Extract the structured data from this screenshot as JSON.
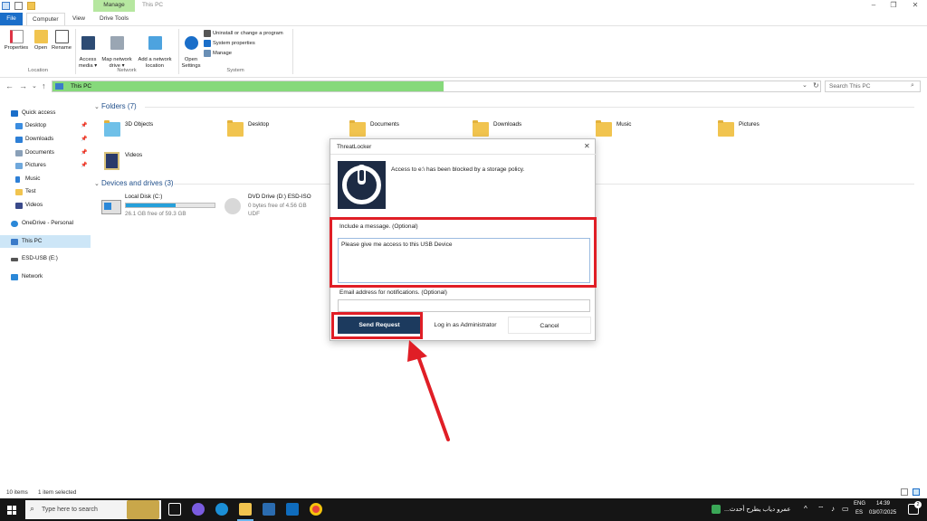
{
  "window": {
    "title": "This PC",
    "manage_tab": "Manage"
  },
  "ribbon": {
    "tabs": [
      "File",
      "Computer",
      "View",
      "Drive Tools"
    ],
    "location_group": {
      "label": "Location",
      "buttons": [
        "Properties",
        "Open",
        "Rename"
      ]
    },
    "network_group": {
      "label": "Network",
      "access_media": "Access\nmedia ▾",
      "map_drive": "Map network\ndrive ▾",
      "add_location": "Add a network\nlocation"
    },
    "system_group": {
      "label": "System",
      "open_settings": "Open\nSettings",
      "items": [
        "Uninstall or change a program",
        "System properties",
        "Manage"
      ]
    }
  },
  "address_bar": {
    "path": "This PC",
    "search_placeholder": "Search This PC"
  },
  "sidebar": {
    "items": [
      {
        "label": "Quick access",
        "pinned": false
      },
      {
        "label": "Desktop",
        "pinned": true
      },
      {
        "label": "Downloads",
        "pinned": true
      },
      {
        "label": "Documents",
        "pinned": true
      },
      {
        "label": "Pictures",
        "pinned": true
      },
      {
        "label": "Music",
        "pinned": false
      },
      {
        "label": "Test",
        "pinned": false
      },
      {
        "label": "Videos",
        "pinned": false
      },
      {
        "label": "OneDrive - Personal",
        "pinned": false
      },
      {
        "label": "This PC",
        "pinned": false
      },
      {
        "label": "ESD-USB (E:)",
        "pinned": false
      },
      {
        "label": "Network",
        "pinned": false
      }
    ]
  },
  "content": {
    "folders_header": "Folders (7)",
    "folders": [
      "3D Objects",
      "Desktop",
      "Documents",
      "Downloads",
      "Music",
      "Pictures",
      "Videos"
    ],
    "devices_header": "Devices and drives (3)",
    "drives": [
      {
        "name": "Local Disk (C:)",
        "detail": "26.1 GB free of 59.3 GB",
        "used_fraction": 0.56
      },
      {
        "name": "DVD Drive (D:) ESD-ISO",
        "detail": "0 bytes free of 4.56 GB",
        "detail2": "UDF"
      }
    ]
  },
  "dialog": {
    "title": "ThreatLocker",
    "message": "Access to e:\\ has been blocked by a storage policy.",
    "include_label": "Include a message. (Optional)",
    "message_value": "Please give me access to this USB Device",
    "email_label": "Email address for notifications. (Optional)",
    "email_value": "",
    "send_button": "Send Request",
    "admin_button": "Log in as Administrator",
    "cancel_button": "Cancel"
  },
  "statusbar": {
    "items_count": "10 items",
    "selected": "1 item selected"
  },
  "taskbar": {
    "search_placeholder": "Type here to search",
    "news": "عمرو دياب يطرح أحدث...",
    "lang_top": "ENG",
    "lang_bottom": "ES",
    "time": "14:39",
    "date": "03/07/2025",
    "notification_count": "2"
  },
  "colors": {
    "accent": "#1a6ec9",
    "progress_green": "#86d97b",
    "dialog_button": "#1c3a5e",
    "annotation_red": "#e01e26"
  }
}
